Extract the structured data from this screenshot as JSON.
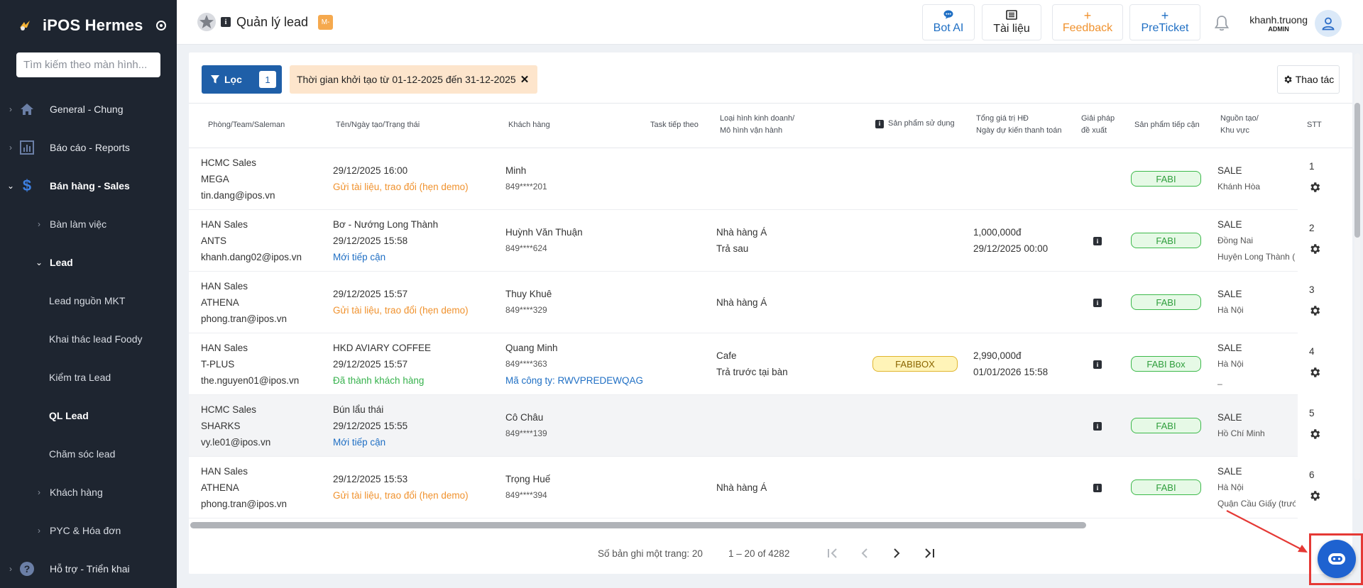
{
  "sidebar": {
    "brand": "iPOS Hermes",
    "search_placeholder": "Tìm kiếm theo màn hình...",
    "items": [
      {
        "label": "General - Chung",
        "icon": "home-icon"
      },
      {
        "label": "Báo cáo - Reports",
        "icon": "bar-chart-icon"
      },
      {
        "label": "Bán hàng - Sales",
        "icon": "dollar-icon"
      },
      {
        "label": "Bàn làm việc"
      },
      {
        "label": "Lead"
      },
      {
        "label": "Lead nguồn MKT"
      },
      {
        "label": "Khai thác lead Foody"
      },
      {
        "label": "Kiểm tra Lead"
      },
      {
        "label": "QL Lead"
      },
      {
        "label": "Chăm sóc lead"
      },
      {
        "label": "Khách hàng"
      },
      {
        "label": "PYC & Hóa đơn"
      },
      {
        "label": "Hỗ trợ - Triển khai",
        "icon": "help-icon"
      }
    ]
  },
  "header": {
    "page_title": "Quản lý lead",
    "badge": "M-",
    "buttons": [
      {
        "label": "Bot AI",
        "icon": "chat-bubble-icon",
        "color": "#1f6fc4"
      },
      {
        "label": "Tài liệu",
        "icon": "book-icon",
        "color": "#222222"
      },
      {
        "label": "Feedback",
        "icon": "plus-icon",
        "color": "#f0922e"
      },
      {
        "label": "PreTicket",
        "icon": "plus-icon",
        "color": "#1f6fc4"
      }
    ],
    "user_name": "khanh.truong",
    "user_role": "ADMIN"
  },
  "toolbar": {
    "filter_label": "Lọc",
    "filter_count": "1",
    "filter_chip": "Thời gian khởi tạo từ 01-12-2025 đến 31-12-2025",
    "action_label": "Thao tác"
  },
  "table": {
    "headers": {
      "team": "Phòng/Team/Saleman",
      "name": "Tên/Ngày tạo/Trạng thái",
      "customer": "Khách hàng",
      "task": "Task tiếp theo",
      "business_1": "Loại hình kinh doanh/",
      "business_2": "Mô hình vận hành",
      "product_used": "Sản phẩm sử dụng",
      "value_1": "Tổng giá trị HĐ",
      "value_2": "Ngày dự kiến thanh toán",
      "solution_1": "Giải pháp",
      "solution_2": "đề xuất",
      "approach": "Sản phẩm tiếp cận",
      "source_1": "Nguồn tạo/",
      "source_2": "Khu vực",
      "stt": "STT"
    },
    "rows": [
      {
        "team": "HCMC Sales",
        "subteam": "MEGA",
        "email": "tin.dang@ipos.vn",
        "name": "",
        "date": "29/12/2025  16:00",
        "status": "Gửi tài liệu, trao đổi (hẹn demo)",
        "status_type": "orange",
        "customer": "Minh",
        "phone": "849****201",
        "company": "",
        "business": "",
        "model": "",
        "product_used": "",
        "value": "",
        "pay_date": "",
        "solution_info": false,
        "approach": "FABI",
        "source": "SALE",
        "region": "Khánh Hòa",
        "district": "",
        "stt": "1"
      },
      {
        "team": "HAN Sales",
        "subteam": "ANTS",
        "email": "khanh.dang02@ipos.vn",
        "name": "Bơ - Nướng Long Thành",
        "date": "29/12/2025  15:58",
        "status": "Mới tiếp cận",
        "status_type": "blue",
        "customer": "Huỳnh Văn Thuận",
        "phone": "849****624",
        "company": "",
        "business": "Nhà hàng Á",
        "model": "Trả sau",
        "product_used": "",
        "value": "1,000,000đ",
        "pay_date": "29/12/2025 00:00",
        "solution_info": true,
        "approach": "FABI",
        "source": "SALE",
        "region": "Đồng Nai",
        "district": "Huyện Long Thành (",
        "stt": "2"
      },
      {
        "team": "HAN Sales",
        "subteam": "ATHENA",
        "email": "phong.tran@ipos.vn",
        "name": "",
        "date": "29/12/2025  15:57",
        "status": "Gửi tài liệu, trao đổi (hẹn demo)",
        "status_type": "orange",
        "customer": "Thuy Khuê",
        "phone": "849****329",
        "company": "",
        "business": "Nhà hàng Á",
        "model": "",
        "product_used": "",
        "value": "",
        "pay_date": "",
        "solution_info": true,
        "approach": "FABI",
        "source": "SALE",
        "region": "Hà Nội",
        "district": "",
        "stt": "3"
      },
      {
        "team": "HAN Sales",
        "subteam": "T-PLUS",
        "email": "the.nguyen01@ipos.vn",
        "name": "HKD AVIARY COFFEE",
        "date": "29/12/2025  15:57",
        "status": "Đã thành khách hàng",
        "status_type": "green",
        "customer": "Quang Minh",
        "phone": "849****363",
        "company": "Mã công ty: RWVPREDEWQAG",
        "business": "Cafe",
        "model": "Trả trước tại bàn",
        "product_used": "FABIBOX",
        "value": "2,990,000đ",
        "pay_date": "01/01/2026 15:58",
        "solution_info": true,
        "approach": "FABI Box",
        "source": "SALE",
        "region": "Hà Nội",
        "district": "_",
        "stt": "4"
      },
      {
        "team": "HCMC Sales",
        "subteam": "SHARKS",
        "email": "vy.le01@ipos.vn",
        "name": "Bún lẩu thái",
        "date": "29/12/2025  15:55",
        "status": "Mới tiếp cận",
        "status_type": "blue",
        "customer": "Cô Châu",
        "phone": "849****139",
        "company": "",
        "business": "",
        "model": "",
        "product_used": "",
        "value": "",
        "pay_date": "",
        "solution_info": true,
        "approach": "FABI",
        "source": "SALE",
        "region": "Hồ Chí Minh",
        "district": "",
        "stt": "5"
      },
      {
        "team": "HAN Sales",
        "subteam": "ATHENA",
        "email": "phong.tran@ipos.vn",
        "name": "",
        "date": "29/12/2025  15:53",
        "status": "Gửi tài liệu, trao đổi (hẹn demo)",
        "status_type": "orange",
        "customer": "Trọng Huế",
        "phone": "849****394",
        "company": "",
        "business": "Nhà hàng Á",
        "model": "",
        "product_used": "",
        "value": "",
        "pay_date": "",
        "solution_info": true,
        "approach": "FABI",
        "source": "SALE",
        "region": "Hà Nội",
        "district": "Quận Cầu Giấy (trước",
        "stt": "6"
      }
    ]
  },
  "pagination": {
    "page_size_label": "Số bản ghi một trang: 20",
    "range_label": "1 – 20 of 4282"
  },
  "colors": {
    "sidebar_bg": "#1e2530",
    "primary": "#1f5fa8",
    "chip_bg": "#fde5cc",
    "status_orange": "#f0922e",
    "status_blue": "#1f6fc4",
    "status_green": "#37b24d",
    "highlight_frame": "#e53935"
  }
}
